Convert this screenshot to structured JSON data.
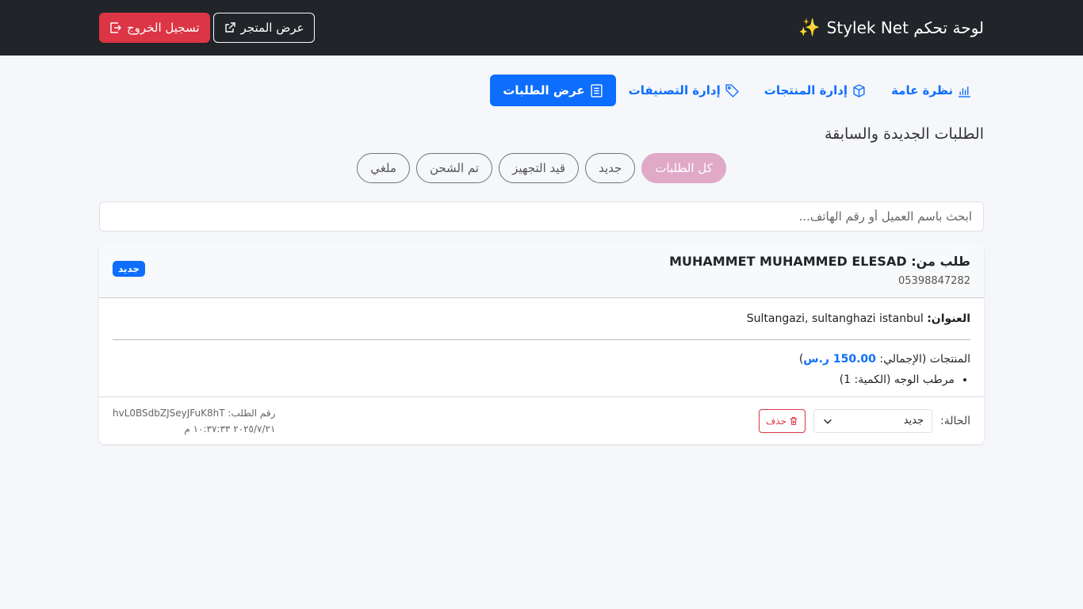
{
  "header": {
    "title": "لوحة تحكم Stylek Net",
    "store_label": "عرض المتجر",
    "logout_label": "تسجيل الخروج"
  },
  "tabs": [
    {
      "label": "نظرة عامة",
      "icon": "bar-chart-icon"
    },
    {
      "label": "إدارة المنتجات",
      "icon": "box-icon"
    },
    {
      "label": "إدارة التصنيفات",
      "icon": "tag-icon"
    },
    {
      "label": "عرض الطلبات",
      "icon": "list-icon",
      "active": true
    }
  ],
  "section_title": "الطلبات الجديدة والسابقة",
  "filters": [
    "كل الطلبات",
    "جديد",
    "قيد التجهيز",
    "تم الشحن",
    "ملغي"
  ],
  "search": {
    "placeholder": "ابحث باسم العميل أو رقم الهاتف..."
  },
  "order": {
    "title_prefix": "طلب من:",
    "customer_name": "MUHAMMET MUHAMMED ELESAD",
    "phone": "05398847282",
    "badge": "جديد",
    "address_label": "العنوان:",
    "address": "Sultangazi, sultanghazi istanbul",
    "products_label": "المنتجات (الإجمالي:",
    "total": "150.00 ر.س",
    "products_close": ")",
    "items": [
      "مرطب الوجه (الكمية: 1)"
    ],
    "status_label": "الحالة:",
    "status_value": "جديد",
    "delete_label": "حذف",
    "order_id_label": "رقم الطلب:",
    "order_id": "hvL0BSdbZJSeyJFuK8hT",
    "date": "٢٠٢٥/٧/٢١ ١٠:٣٧:٣٣ م"
  },
  "colors": {
    "navbar": "#212529",
    "primary": "#0d6efd",
    "danger": "#dc3545",
    "active_filter": "#e0a9c8"
  }
}
